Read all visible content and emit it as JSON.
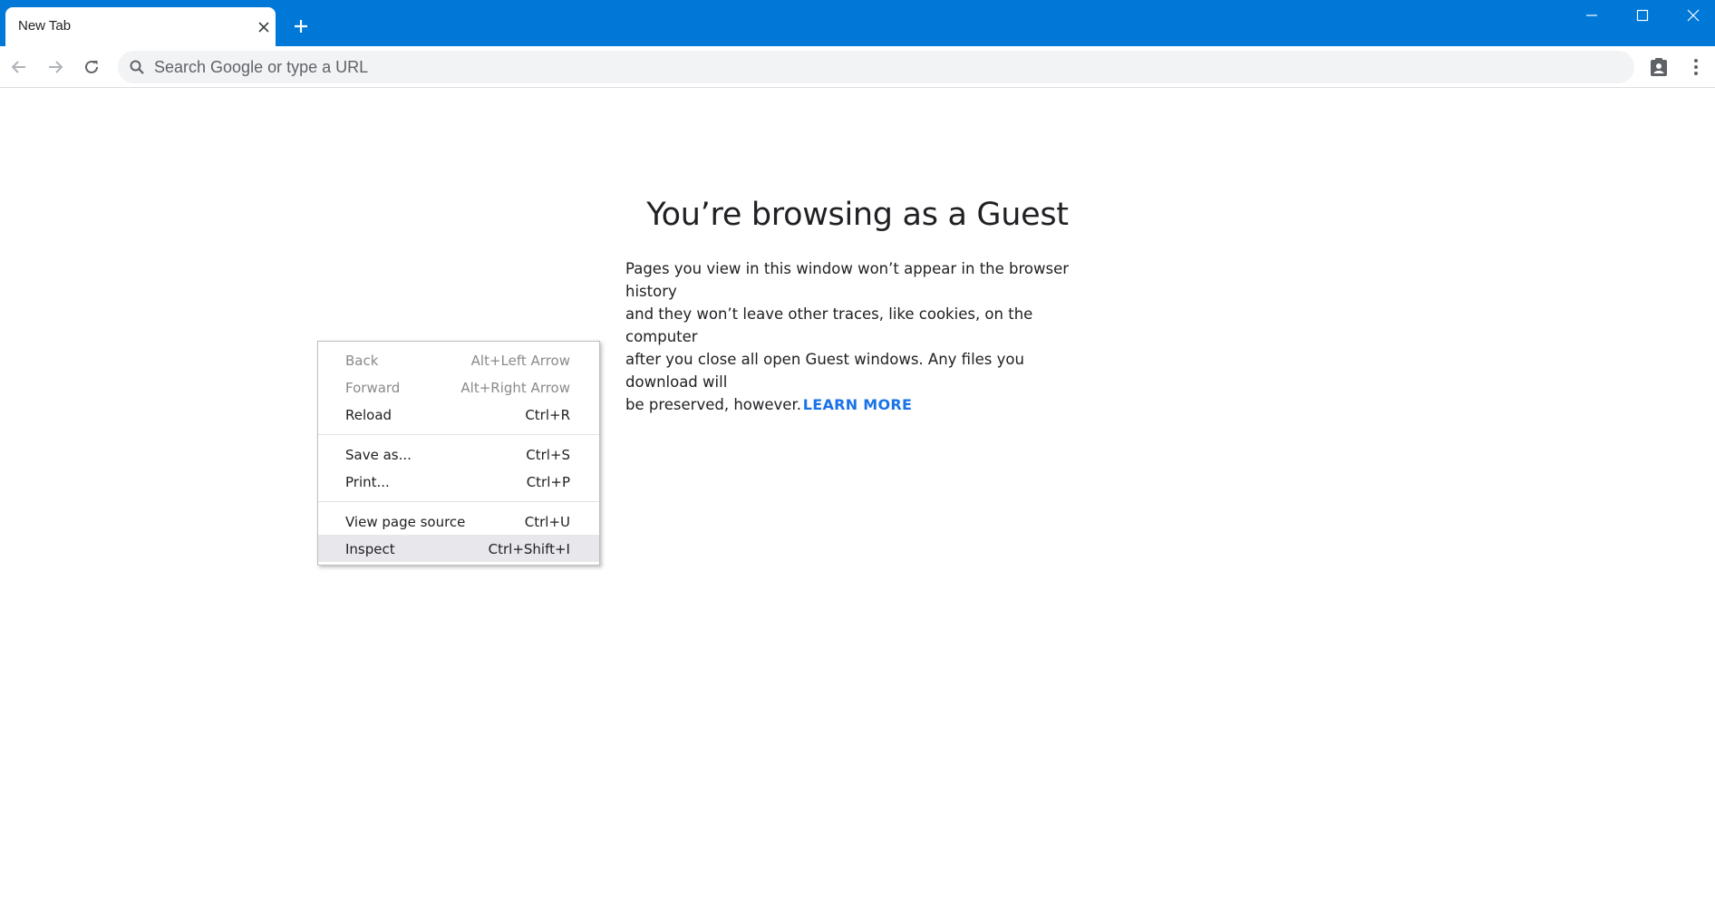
{
  "tabs": [
    {
      "title": "New Tab"
    }
  ],
  "window": {
    "controls": [
      "minimize",
      "maximize",
      "close"
    ]
  },
  "toolbar": {
    "search_placeholder": "Search Google or type a URL",
    "icons": [
      "back-arrow-icon",
      "forward-arrow-icon",
      "reload-icon",
      "search-icon",
      "guest-profile-icon",
      "more-vert-icon"
    ]
  },
  "page": {
    "heading": "You’re browsing as a Guest",
    "paragraph_lines": [
      "Pages you view in this window won’t appear in the browser history",
      "and they won’t leave other traces, like cookies, on the computer",
      "after you close all open Guest windows. Any files you download will",
      "be preserved, however."
    ],
    "learn_more": "LEARN MORE"
  },
  "context_menu": {
    "groups": [
      [
        {
          "label": "Back",
          "shortcut": "Alt+Left Arrow",
          "disabled": true
        },
        {
          "label": "Forward",
          "shortcut": "Alt+Right Arrow",
          "disabled": true
        },
        {
          "label": "Reload",
          "shortcut": "Ctrl+R",
          "disabled": false
        }
      ],
      [
        {
          "label": "Save as...",
          "shortcut": "Ctrl+S",
          "disabled": false
        },
        {
          "label": "Print...",
          "shortcut": "Ctrl+P",
          "disabled": false
        }
      ],
      [
        {
          "label": "View page source",
          "shortcut": "Ctrl+U",
          "disabled": false
        },
        {
          "label": "Inspect",
          "shortcut": "Ctrl+Shift+I",
          "disabled": false,
          "highlighted": true
        }
      ]
    ]
  },
  "colors": {
    "titlebar": "#0078d7",
    "omnibox": "#f1f3f4",
    "link": "#1a73e8",
    "menu_highlight": "#e8e8ec"
  }
}
